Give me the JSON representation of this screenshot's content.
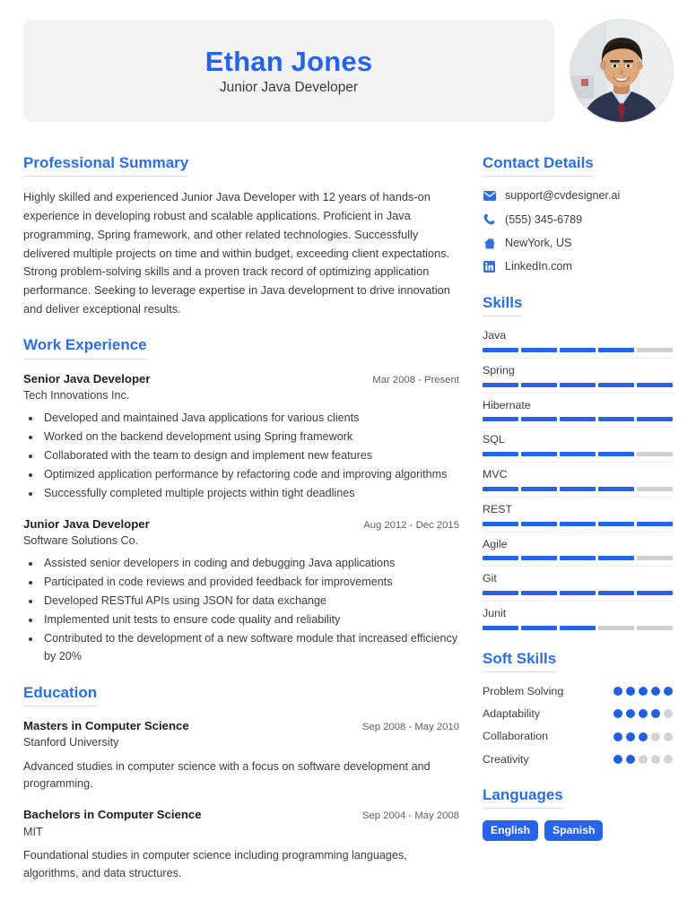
{
  "header": {
    "full_name": "Ethan Jones",
    "job_title": "Junior Java Developer",
    "avatar_name": "profile-photo",
    "accent_color": "#2563eb",
    "box_background": "#f2f2f2"
  },
  "summary": {
    "heading": "Professional Summary",
    "text": "Highly skilled and experienced Junior Java Developer with 12 years of hands-on experience in developing robust and scalable applications. Proficient in Java programming, Spring framework, and other related technologies. Successfully delivered multiple projects on time and within budget, exceeding client expectations. Strong problem-solving skills and a proven track record of optimizing application performance. Seeking to leverage expertise in Java development to drive innovation and deliver exceptional results."
  },
  "work_experience": {
    "heading": "Work Experience",
    "entries": [
      {
        "role": "Senior Java Developer",
        "date": "Mar 2008 - Present",
        "organization": "Tech Innovations Inc.",
        "bullets": [
          "Developed and maintained Java applications for various clients",
          "Worked on the backend development using Spring framework",
          "Collaborated with the team to design and implement new features",
          "Optimized application performance by refactoring code and improving algorithms",
          "Successfully completed multiple projects within tight deadlines"
        ]
      },
      {
        "role": "Junior Java Developer",
        "date": "Aug 2012 - Dec 2015",
        "organization": "Software Solutions Co.",
        "bullets": [
          "Assisted senior developers in coding and debugging Java applications",
          "Participated in code reviews and provided feedback for improvements",
          "Developed RESTful APIs using JSON for data exchange",
          "Implemented unit tests to ensure code quality and reliability",
          "Contributed to the development of a new software module that increased efficiency by 20%"
        ]
      }
    ]
  },
  "education": {
    "heading": "Education",
    "entries": [
      {
        "degree": "Masters in Computer Science",
        "date": "Sep 2008 - May 2010",
        "school": "Stanford University",
        "description": "Advanced studies in computer science with a focus on software development and programming."
      },
      {
        "degree": "Bachelors in Computer Science",
        "date": "Sep 2004 - May 2008",
        "school": "MIT",
        "description": "Foundational studies in computer science including programming languages, algorithms, and data structures."
      }
    ]
  },
  "contact": {
    "heading": "Contact Details",
    "items": [
      {
        "icon": "envelope-icon",
        "value": "support@cvdesigner.ai"
      },
      {
        "icon": "phone-icon",
        "value": "(555) 345-6789"
      },
      {
        "icon": "home-icon",
        "value": "NewYork, US"
      },
      {
        "icon": "linkedin-icon",
        "value": "LinkedIn.com"
      }
    ]
  },
  "skills": {
    "heading": "Skills",
    "max_level": 5,
    "items": [
      {
        "name": "Java",
        "level": 4
      },
      {
        "name": "Spring",
        "level": 5
      },
      {
        "name": "Hibernate",
        "level": 5
      },
      {
        "name": "SQL",
        "level": 4
      },
      {
        "name": "MVC",
        "level": 4
      },
      {
        "name": "REST",
        "level": 5
      },
      {
        "name": "Agile",
        "level": 4
      },
      {
        "name": "Git",
        "level": 5
      },
      {
        "name": "Junit",
        "level": 3
      }
    ]
  },
  "soft_skills": {
    "heading": "Soft Skills",
    "max_level": 5,
    "items": [
      {
        "name": "Problem Solving",
        "level": 5
      },
      {
        "name": "Adaptability",
        "level": 4
      },
      {
        "name": "Collaboration",
        "level": 3
      },
      {
        "name": "Creativity",
        "level": 2
      }
    ]
  },
  "languages": {
    "heading": "Languages",
    "items": [
      "English",
      "Spanish"
    ]
  }
}
